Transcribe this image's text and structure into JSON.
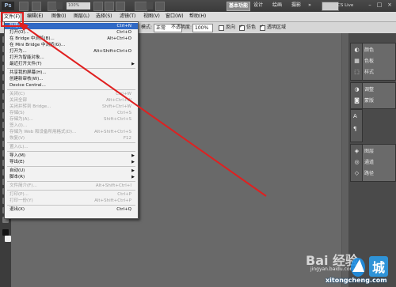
{
  "app": {
    "logo": "Ps",
    "zoom": "100%",
    "workspaces": [
      "基本功能",
      "设计",
      "绘画",
      "摄影"
    ],
    "active_workspace": 0,
    "cs_live": "CS Live"
  },
  "menubar": {
    "items": [
      "文件(F)",
      "编辑(E)",
      "图像(I)",
      "图层(L)",
      "选择(S)",
      "滤镜(T)",
      "视图(V)",
      "窗口(W)",
      "帮助(H)"
    ],
    "open_index": 0
  },
  "options": {
    "mode_label": "模式:",
    "mode_value": "正常",
    "opacity_label": "不透明度:",
    "opacity_value": "100%",
    "reverse_label": "反向",
    "dither_label": "仿色",
    "transparency_label": "透明区域"
  },
  "file_menu": [
    {
      "label": "新建(N)...",
      "shortcut": "Ctrl+N",
      "selected": true,
      "disabled": false
    },
    {
      "label": "打开(O)...",
      "shortcut": "Ctrl+O",
      "disabled": false
    },
    {
      "label": "在 Bridge 中浏览(B)...",
      "shortcut": "Alt+Ctrl+O",
      "disabled": false
    },
    {
      "label": "在 Mini Bridge 中浏览(G)...",
      "shortcut": "",
      "disabled": false
    },
    {
      "label": "打开为...",
      "shortcut": "Alt+Shift+Ctrl+O",
      "disabled": false
    },
    {
      "label": "打开为智能对象...",
      "shortcut": "",
      "disabled": false
    },
    {
      "label": "最近打开文件(T)",
      "shortcut": "",
      "submenu": true,
      "disabled": false
    },
    {
      "sep": true
    },
    {
      "label": "共享我的屏幕(H)...",
      "shortcut": "",
      "disabled": false
    },
    {
      "label": "创建新审核(W)...",
      "shortcut": "",
      "disabled": false
    },
    {
      "label": "Device Central...",
      "shortcut": "",
      "disabled": false
    },
    {
      "sep": true
    },
    {
      "label": "关闭(C)",
      "shortcut": "Ctrl+W",
      "disabled": true
    },
    {
      "label": "关闭全部",
      "shortcut": "Alt+Ctrl+W",
      "disabled": true
    },
    {
      "label": "关闭并转到 Bridge...",
      "shortcut": "Shift+Ctrl+W",
      "disabled": true
    },
    {
      "label": "存储(S)",
      "shortcut": "Ctrl+S",
      "disabled": true
    },
    {
      "label": "存储为(A)...",
      "shortcut": "Shift+Ctrl+S",
      "disabled": true
    },
    {
      "label": "签入(I)...",
      "shortcut": "",
      "disabled": true
    },
    {
      "label": "存储为 Web 和设备所用格式(D)...",
      "shortcut": "Alt+Shift+Ctrl+S",
      "disabled": true
    },
    {
      "label": "恢复(V)",
      "shortcut": "F12",
      "disabled": true
    },
    {
      "sep": true
    },
    {
      "label": "置入(L)...",
      "shortcut": "",
      "disabled": true
    },
    {
      "sep": true
    },
    {
      "label": "导入(M)",
      "shortcut": "",
      "submenu": true,
      "disabled": false
    },
    {
      "label": "导出(E)",
      "shortcut": "",
      "submenu": true,
      "disabled": false
    },
    {
      "sep": true
    },
    {
      "label": "自动(U)",
      "shortcut": "",
      "submenu": true,
      "disabled": false
    },
    {
      "label": "脚本(R)",
      "shortcut": "",
      "submenu": true,
      "disabled": false
    },
    {
      "sep": true
    },
    {
      "label": "文件简介(F)...",
      "shortcut": "Alt+Shift+Ctrl+I",
      "disabled": true
    },
    {
      "sep": true
    },
    {
      "label": "打印(P)...",
      "shortcut": "Ctrl+P",
      "disabled": true
    },
    {
      "label": "打印一份(Y)",
      "shortcut": "Alt+Shift+Ctrl+P",
      "disabled": true
    },
    {
      "sep": true
    },
    {
      "label": "退出(X)",
      "shortcut": "Ctrl+Q",
      "disabled": false
    }
  ],
  "panels": {
    "group1": [
      "颜色",
      "色板",
      "样式"
    ],
    "group2": [
      "调整",
      "蒙版"
    ],
    "group3": [
      "图层",
      "通道",
      "路径"
    ]
  },
  "watermark": {
    "main": "Bai 经验",
    "url": "jingyan.baidu.com",
    "site": "xitongcheng.com"
  },
  "colors": {
    "highlight": "#e02020",
    "menu_selected": "#316ac5"
  }
}
